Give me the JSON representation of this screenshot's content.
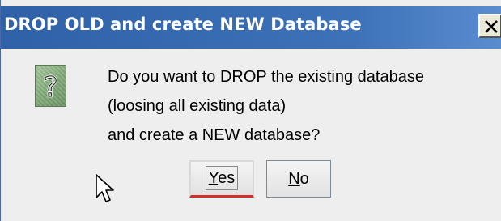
{
  "dialog": {
    "title": "DROP OLD and create NEW Database",
    "close_glyph": "X",
    "icon": "question-icon",
    "icon_glyph": "?",
    "message": [
      "Do you want to DROP the existing database",
      "(loosing all existing data)",
      "and create a NEW database?"
    ],
    "buttons": {
      "yes_mnemonic": "Y",
      "yes_rest": "es",
      "no_mnemonic": "N",
      "no_rest": "o"
    }
  },
  "colors": {
    "titlebar": "#2f61a8",
    "body": "#eeeeee",
    "icon_bg": "#7fa877",
    "focus_accent": "#d0312d"
  }
}
